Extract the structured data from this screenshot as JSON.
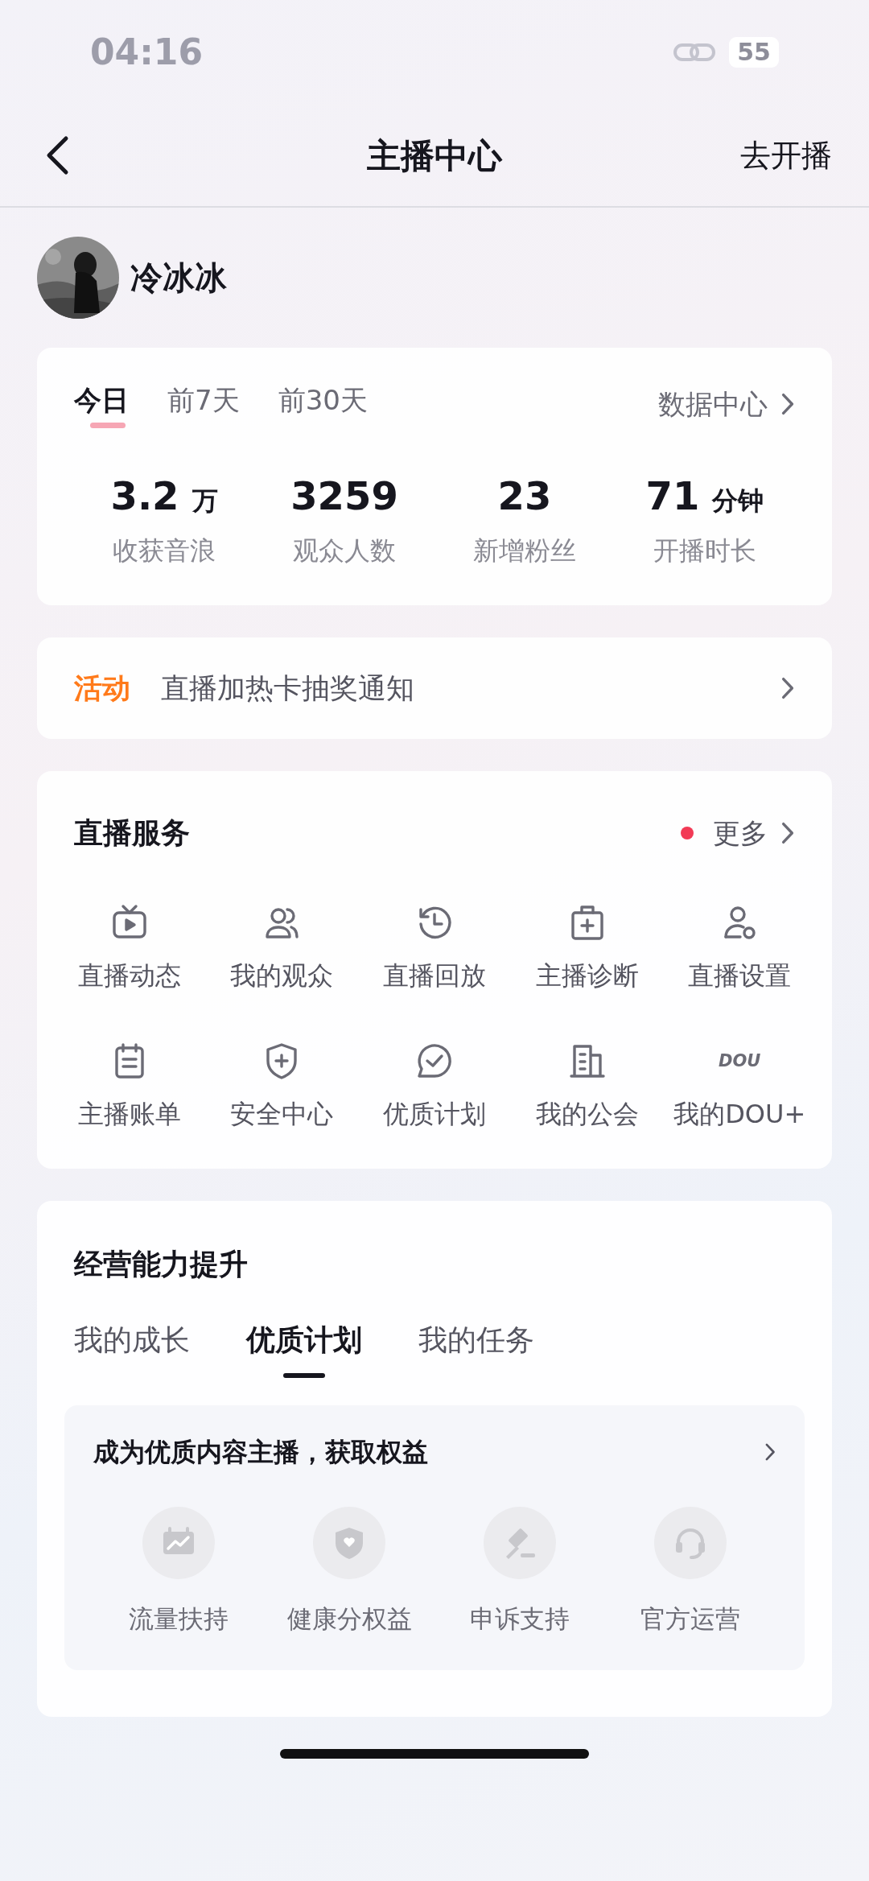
{
  "status_bar": {
    "time": "04:16",
    "battery": "55"
  },
  "nav": {
    "title": "主播中心",
    "action": "去开播"
  },
  "profile": {
    "name": "冷冰冰"
  },
  "stats": {
    "periods": [
      {
        "label": "今日",
        "selected": true
      },
      {
        "label": "前7天",
        "selected": false
      },
      {
        "label": "前30天",
        "selected": false
      }
    ],
    "link": "数据中心",
    "metrics": [
      {
        "value": "3.2",
        "unit": "万",
        "label": "收获音浪"
      },
      {
        "value": "3259",
        "label": "观众人数"
      },
      {
        "value": "23",
        "label": "新增粉丝"
      },
      {
        "value": "71",
        "unit": "分钟",
        "label": "开播时长"
      }
    ]
  },
  "activity": {
    "tag": "活动",
    "text": "直播加热卡抽奖通知"
  },
  "services": {
    "title": "直播服务",
    "more": "更多",
    "more_dot": true,
    "items": [
      {
        "label": "直播动态"
      },
      {
        "label": "我的观众"
      },
      {
        "label": "直播回放"
      },
      {
        "label": "主播诊断"
      },
      {
        "label": "直播设置"
      },
      {
        "label": "主播账单"
      },
      {
        "label": "安全中心"
      },
      {
        "label": "优质计划"
      },
      {
        "label": "我的公会"
      },
      {
        "label": "我的DOU+",
        "icon_text": "DOU"
      }
    ]
  },
  "growth": {
    "title": "经营能力提升",
    "tabs": [
      {
        "label": "我的成长",
        "selected": false
      },
      {
        "label": "优质计划",
        "selected": true
      },
      {
        "label": "我的任务",
        "selected": false
      }
    ],
    "panel": {
      "title": "成为优质内容主播，获取权益",
      "benefits": [
        {
          "label": "流量扶持"
        },
        {
          "label": "健康分权益"
        },
        {
          "label": "申诉支持"
        },
        {
          "label": "官方运营"
        }
      ]
    }
  }
}
